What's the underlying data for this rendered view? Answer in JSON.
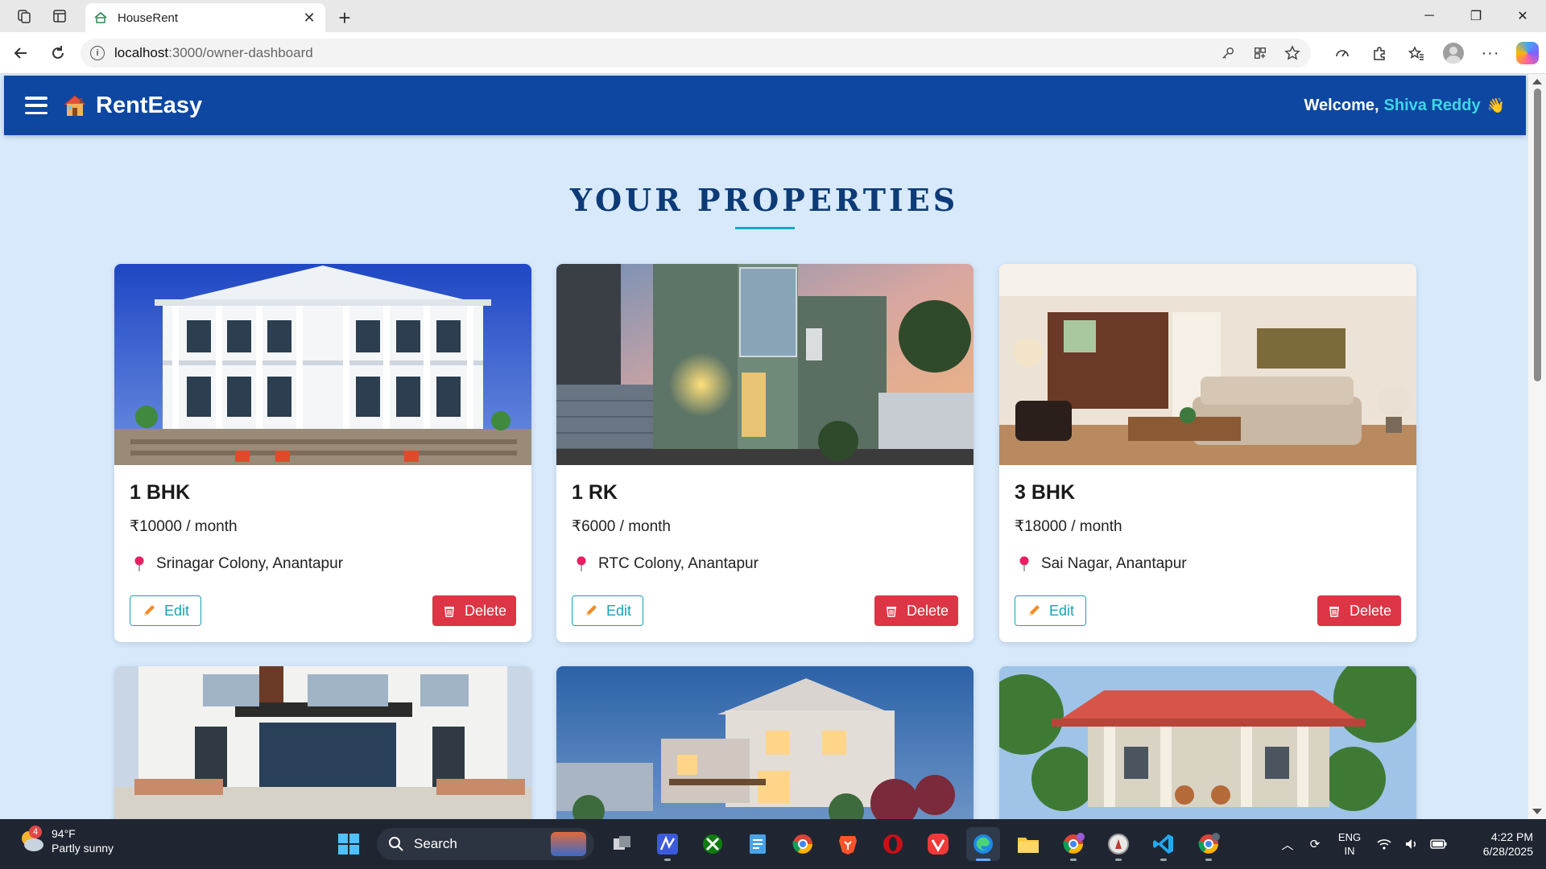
{
  "browser": {
    "tab_title": "HouseRent",
    "url_host": "localhost",
    "url_path": ":3000/owner-dashboard"
  },
  "app": {
    "brand": "RentEasy",
    "welcome_prefix": "Welcome,",
    "user_name": "Shiva Reddy",
    "wave": "👋",
    "section_title": "YOUR PROPERTIES"
  },
  "properties": [
    {
      "title": "1 BHK",
      "price": "₹10000 / month",
      "location": "Srinagar Colony, Anantapur",
      "edit": "Edit",
      "delete": "Delete"
    },
    {
      "title": "1 RK",
      "price": "₹6000 / month",
      "location": "RTC Colony, Anantapur",
      "edit": "Edit",
      "delete": "Delete"
    },
    {
      "title": "3 BHK",
      "price": "₹18000 / month",
      "location": "Sai Nagar, Anantapur",
      "edit": "Edit",
      "delete": "Delete"
    },
    {
      "title": "",
      "price": "",
      "location": "",
      "edit": "",
      "delete": ""
    },
    {
      "title": "",
      "price": "",
      "location": "",
      "edit": "",
      "delete": ""
    },
    {
      "title": "",
      "price": "",
      "location": "",
      "edit": "",
      "delete": ""
    }
  ],
  "taskbar": {
    "weather_badge": "4",
    "temperature": "94°F",
    "condition": "Partly sunny",
    "search_label": "Search",
    "lang_line1": "ENG",
    "lang_line2": "IN",
    "time": "4:22 PM",
    "date": "6/28/2025"
  },
  "colors": {
    "appbar": "#0d47a1",
    "accent_cyan": "#17a2b8",
    "delete_red": "#dc3545",
    "page_bg": "#d7e9fb",
    "title_navy": "#0d3b77"
  }
}
